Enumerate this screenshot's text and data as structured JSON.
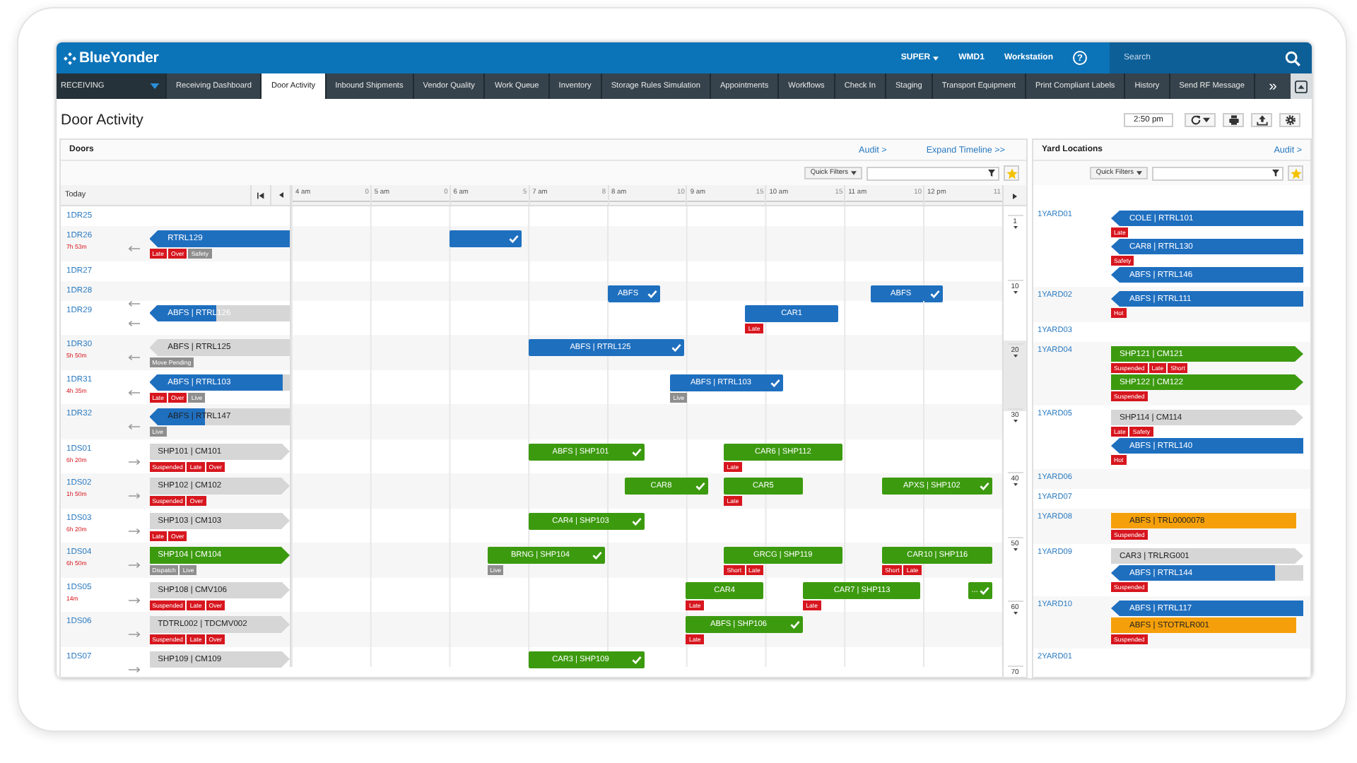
{
  "app": {
    "logo": "BlueYonder",
    "user": "SUPER",
    "warehouse": "WMD1",
    "workstation": "Workstation",
    "help": "?",
    "search": {
      "placeholder": "Search"
    }
  },
  "nav": {
    "module": "RECEIVING",
    "more": "»",
    "tabs": [
      {
        "label": "Receiving Dashboard",
        "selected": false
      },
      {
        "label": "Door Activity",
        "selected": true
      },
      {
        "label": "Inbound Shipments",
        "selected": false
      },
      {
        "label": "Vendor Quality",
        "selected": false
      },
      {
        "label": "Work Queue",
        "selected": false
      },
      {
        "label": "Inventory",
        "selected": false
      },
      {
        "label": "Storage Rules Simulation",
        "selected": false
      },
      {
        "label": "Appointments",
        "selected": false
      },
      {
        "label": "Workflows",
        "selected": false
      },
      {
        "label": "Check In",
        "selected": false
      },
      {
        "label": "Staging",
        "selected": false
      },
      {
        "label": "Transport Equipment",
        "selected": false
      },
      {
        "label": "Print Compliant Labels",
        "selected": false
      },
      {
        "label": "History",
        "selected": false
      },
      {
        "label": "Send RF Message",
        "selected": false
      }
    ]
  },
  "page": {
    "title": "Door Activity",
    "time": "2:50 pm"
  },
  "doors_panel": {
    "title": "Doors",
    "audit": "Audit >",
    "expand": "Expand Timeline >>",
    "quick_filters": "Quick Filters",
    "today": "Today",
    "timeline": {
      "hours": [
        {
          "label": "4 am",
          "count": "0"
        },
        {
          "label": "5 am",
          "count": "0"
        },
        {
          "label": "6 am",
          "count": "5"
        },
        {
          "label": "7 am",
          "count": "8"
        },
        {
          "label": "8 am",
          "count": "10"
        },
        {
          "label": "9 am",
          "count": "15"
        },
        {
          "label": "10 am",
          "count": "15"
        },
        {
          "label": "11 am",
          "count": "10"
        },
        {
          "label": "12 pm",
          "count": "11"
        }
      ]
    },
    "ruler": [
      "1",
      "10",
      "20",
      "30",
      "40",
      "50",
      "60",
      "70"
    ],
    "doors": [
      {
        "name": "1DR25",
        "kind": "inbound"
      },
      {
        "name": "1DR26",
        "kind": "inbound",
        "dwell": "7h 53m",
        "bar": {
          "label": "RTRL129",
          "color": "#1f6fbf"
        },
        "tags": [
          {
            "text": "Late",
            "color": "#d7161e"
          },
          {
            "text": "Over",
            "color": "#d7161e"
          },
          {
            "text": "Safety",
            "color": "#8e8e8e"
          }
        ],
        "slots": [
          {
            "color": "#1f6fbf",
            "done": true
          }
        ]
      },
      {
        "name": "1DR27",
        "kind": "inbound"
      },
      {
        "name": "1DR28",
        "kind": "inbound",
        "slots": [
          {
            "label": "ABFS",
            "color": "#1f6fbf",
            "done": true
          },
          {
            "label": "ABFS",
            "color": "#1f6fbf",
            "done": true
          }
        ]
      },
      {
        "name": "1DR29",
        "kind": "inbound",
        "bar": {
          "label": "ABFS | RTRL126",
          "color": "#1f6fbf",
          "level": 0.48
        },
        "slots": [
          {
            "label": "CAR1",
            "color": "#1f6fbf",
            "done": false,
            "tags": [
              {
                "text": "Late",
                "color": "#d7161e"
              }
            ]
          }
        ]
      },
      {
        "name": "1DR30",
        "kind": "inbound",
        "dwell": "5h 50m",
        "bar": {
          "label": "ABFS | RTRL125",
          "color": "#d6d6d6"
        },
        "tags": [
          {
            "text": "Move Pending",
            "color": "#8e8e8e"
          }
        ],
        "slots": [
          {
            "label": "ABFS | RTRL125",
            "color": "#1f6fbf",
            "done": true
          }
        ]
      },
      {
        "name": "1DR31",
        "kind": "inbound",
        "dwell": "4h 35m",
        "bar": {
          "label": "ABFS | RTRL103",
          "color": "#1f6fbf",
          "level": 0.95
        },
        "tags": [
          {
            "text": "Late",
            "color": "#d7161e"
          },
          {
            "text": "Over",
            "color": "#d7161e"
          },
          {
            "text": "Live",
            "color": "#8e8e8e"
          }
        ],
        "slots": [
          {
            "label": "ABFS | RTRL103",
            "color": "#1f6fbf",
            "done": true,
            "tags": [
              {
                "text": "Live",
                "color": "#8e8e8e"
              }
            ]
          }
        ]
      },
      {
        "name": "1DR32",
        "kind": "inbound",
        "bar": {
          "label": "ABFS | RTRL147",
          "color": "#1f6fbf",
          "level": 0.4
        },
        "tags": [
          {
            "text": "Live",
            "color": "#8e8e8e"
          }
        ]
      },
      {
        "name": "1DS01",
        "kind": "outbound",
        "dwell": "6h 20m",
        "bar": {
          "label": "SHP101 | CM101",
          "color": "#d6d6d6"
        },
        "tags": [
          {
            "text": "Suspended",
            "color": "#d7161e"
          },
          {
            "text": "Late",
            "color": "#d7161e"
          },
          {
            "text": "Over",
            "color": "#d7161e"
          }
        ],
        "slots": [
          {
            "label": "ABFS | SHP101",
            "color": "#3c9a0f",
            "done": true
          },
          {
            "label": "CAR6 | SHP112",
            "color": "#3c9a0f",
            "done": false,
            "tags": [
              {
                "text": "Late",
                "color": "#d7161e"
              }
            ]
          }
        ]
      },
      {
        "name": "1DS02",
        "kind": "outbound",
        "dwell": "1h 50m",
        "bar": {
          "label": "SHP102 | CM102",
          "color": "#d6d6d6"
        },
        "tags": [
          {
            "text": "Suspended",
            "color": "#d7161e"
          },
          {
            "text": "Over",
            "color": "#d7161e"
          }
        ],
        "slots": [
          {
            "label": "CAR8",
            "color": "#3c9a0f",
            "done": true
          },
          {
            "label": "CAR5",
            "color": "#3c9a0f",
            "done": false,
            "tags": [
              {
                "text": "Late",
                "color": "#d7161e"
              }
            ]
          },
          {
            "label": "APXS | SHP102",
            "color": "#3c9a0f",
            "done": true
          }
        ]
      },
      {
        "name": "1DS03",
        "kind": "outbound",
        "dwell": "6h 20m",
        "bar": {
          "label": "SHP103 | CM103",
          "color": "#d6d6d6"
        },
        "tags": [
          {
            "text": "Late",
            "color": "#d7161e"
          },
          {
            "text": "Over",
            "color": "#d7161e"
          }
        ],
        "slots": [
          {
            "label": "CAR4 | SHP103",
            "color": "#3c9a0f",
            "done": true
          }
        ]
      },
      {
        "name": "1DS04",
        "kind": "outbound",
        "dwell": "6h 50m",
        "bar": {
          "label": "SHP104 | CM104",
          "color": "#3c9a0f"
        },
        "tags": [
          {
            "text": "Dispatch",
            "color": "#8e8e8e"
          },
          {
            "text": "Live",
            "color": "#8e8e8e"
          }
        ],
        "slots": [
          {
            "label": "BRNG | SHP104",
            "color": "#3c9a0f",
            "done": true,
            "tags": [
              {
                "text": "Live",
                "color": "#8e8e8e"
              }
            ]
          },
          {
            "label": "GRCG | SHP119",
            "color": "#3c9a0f",
            "done": false,
            "tags": [
              {
                "text": "Short",
                "color": "#d7161e"
              },
              {
                "text": "Late",
                "color": "#d7161e"
              }
            ]
          },
          {
            "label": "CAR10 | SHP116",
            "color": "#3c9a0f",
            "done": false,
            "tags": [
              {
                "text": "Short",
                "color": "#d7161e"
              },
              {
                "text": "Late",
                "color": "#d7161e"
              }
            ]
          }
        ]
      },
      {
        "name": "1DS05",
        "kind": "outbound",
        "dwell": "14m",
        "bar": {
          "label": "SHP108 | CMV106",
          "color": "#d6d6d6"
        },
        "tags": [
          {
            "text": "Suspended",
            "color": "#d7161e"
          },
          {
            "text": "Late",
            "color": "#d7161e"
          },
          {
            "text": "Over",
            "color": "#d7161e"
          }
        ],
        "slots": [
          {
            "label": "CAR4",
            "color": "#3c9a0f",
            "done": false,
            "tags": [
              {
                "text": "Late",
                "color": "#d7161e"
              }
            ]
          },
          {
            "label": "CAR7 | SHP113",
            "color": "#3c9a0f",
            "done": false,
            "tags": [
              {
                "text": "Late",
                "color": "#d7161e"
              }
            ]
          },
          {
            "label": "...",
            "color": "#3c9a0f",
            "done": true
          }
        ]
      },
      {
        "name": "1DS06",
        "kind": "outbound",
        "bar": {
          "label": "TDTRL002 | TDCMV002",
          "color": "#d6d6d6"
        },
        "tags": [
          {
            "text": "Suspended",
            "color": "#d7161e"
          },
          {
            "text": "Late",
            "color": "#d7161e"
          },
          {
            "text": "Over",
            "color": "#d7161e"
          }
        ],
        "slots": [
          {
            "label": "ABFS | SHP106",
            "color": "#3c9a0f",
            "done": true,
            "tags": [
              {
                "text": "Late",
                "color": "#d7161e"
              }
            ]
          }
        ]
      },
      {
        "name": "1DS07",
        "kind": "outbound",
        "bar": {
          "label": "SHP109 | CM109",
          "color": "#d6d6d6"
        },
        "slots": [
          {
            "label": "CAR3 | SHP109",
            "color": "#3c9a0f",
            "done": true
          }
        ]
      }
    ]
  },
  "yard_panel": {
    "title": "Yard Locations",
    "audit": "Audit >",
    "quick_filters": "Quick Filters",
    "locations": [
      {
        "name": "1YARD01",
        "items": [
          {
            "label": "COLE | RTRL101",
            "kind": "inbound",
            "color": "#1f6fbf",
            "tags": [
              {
                "text": "Late",
                "color": "#d7161e"
              }
            ]
          },
          {
            "label": "CAR8 | RTRL130",
            "kind": "inbound",
            "color": "#1f6fbf",
            "tags": [
              {
                "text": "Safety",
                "color": "#d7161e"
              }
            ]
          },
          {
            "label": "ABFS | RTRL146",
            "kind": "inbound",
            "color": "#1f6fbf"
          }
        ]
      },
      {
        "name": "1YARD02",
        "items": [
          {
            "label": "ABFS | RTRL111",
            "kind": "inbound",
            "color": "#1f6fbf",
            "tags": [
              {
                "text": "Hot",
                "color": "#d7161e"
              }
            ]
          }
        ]
      },
      {
        "name": "1YARD03"
      },
      {
        "name": "1YARD04",
        "items": [
          {
            "label": "SHP121 | CM121",
            "kind": "outbound",
            "color": "#3c9a0f",
            "tags": [
              {
                "text": "Suspended",
                "color": "#d7161e"
              },
              {
                "text": "Late",
                "color": "#d7161e"
              },
              {
                "text": "Short",
                "color": "#d7161e"
              }
            ]
          },
          {
            "label": "SHP122 | CM122",
            "kind": "outbound",
            "color": "#3c9a0f",
            "tags": [
              {
                "text": "Suspended",
                "color": "#d7161e"
              }
            ]
          }
        ]
      },
      {
        "name": "1YARD05",
        "items": [
          {
            "label": "SHP114 | CM114",
            "kind": "outbound",
            "color": "#d6d6d6",
            "tags": [
              {
                "text": "Late",
                "color": "#d7161e"
              },
              {
                "text": "Safety",
                "color": "#d7161e"
              }
            ]
          },
          {
            "label": "ABFS | RTRL140",
            "kind": "inbound",
            "color": "#1f6fbf",
            "tags": [
              {
                "text": "Hot",
                "color": "#d7161e"
              }
            ]
          }
        ]
      },
      {
        "name": "1YARD06"
      },
      {
        "name": "1YARD07"
      },
      {
        "name": "1YARD08",
        "items": [
          {
            "label": "ABFS | TRL0000078",
            "kind": "plain",
            "color": "#f5a00a",
            "tags": [
              {
                "text": "Suspended",
                "color": "#d7161e"
              }
            ]
          }
        ]
      },
      {
        "name": "1YARD09",
        "items": [
          {
            "label": "CAR3 | TRLRG001",
            "kind": "outbound",
            "color": "#d6d6d6"
          },
          {
            "label": "ABFS | RTRL144",
            "kind": "inbound",
            "color": "#1f6fbf",
            "level": 0.85,
            "tags": [
              {
                "text": "Suspended",
                "color": "#d7161e"
              }
            ]
          }
        ]
      },
      {
        "name": "1YARD10",
        "items": [
          {
            "label": "ABFS | RTRL117",
            "kind": "inbound",
            "color": "#1f6fbf"
          },
          {
            "label": "ABFS | STOTRLR001",
            "kind": "plain",
            "color": "#f5a00a",
            "tags": [
              {
                "text": "Suspended",
                "color": "#d7161e"
              }
            ]
          }
        ]
      },
      {
        "name": "2YARD01"
      }
    ]
  }
}
